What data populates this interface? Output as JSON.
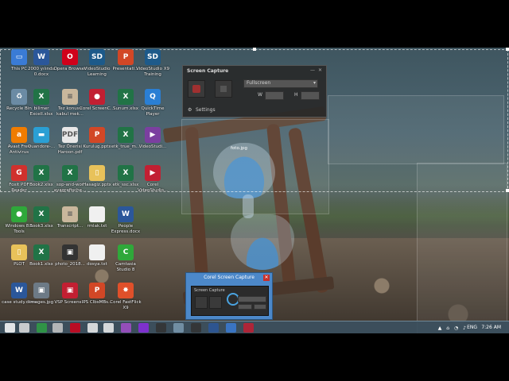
{
  "desktop_icons": [
    {
      "label": "This PC",
      "color": "#3a7bd5",
      "glyph": "▭",
      "icon": "computer-icon"
    },
    {
      "label": "2000 yılında 0.docx",
      "color": "#2b579a",
      "glyph": "W",
      "icon": "word-doc-icon"
    },
    {
      "label": "Opera Browser",
      "color": "#d0021b",
      "glyph": "O",
      "icon": "opera-icon"
    },
    {
      "label": "VideoStudio Learning",
      "color": "#1d5a8a",
      "glyph": "SD",
      "icon": "videostudio-icon"
    },
    {
      "label": "Presentati...",
      "color": "#d24726",
      "glyph": "P",
      "icon": "powerpoint-icon"
    },
    {
      "label": "VideoStudio X9 Training",
      "color": "#1d5a8a",
      "glyph": "SD",
      "icon": "videostudio-icon"
    },
    {
      "label": "Recycle Bin",
      "color": "#6b8ba4",
      "glyph": "♻",
      "icon": "recycle-bin-icon"
    },
    {
      "label": "bilimer Excell.xlsx",
      "color": "#217346",
      "glyph": "X",
      "icon": "excel-icon"
    },
    {
      "label": "Tez konusu kabul mek...",
      "color": "#c9b79c",
      "glyph": "≡",
      "icon": "document-icon"
    },
    {
      "label": "Corel ScreenC...",
      "color": "#c21f32",
      "glyph": "●",
      "icon": "corel-icon"
    },
    {
      "label": "Sunum.xlsx",
      "color": "#217346",
      "glyph": "X",
      "icon": "excel-icon"
    },
    {
      "label": "QuickTime Player",
      "color": "#2a7fd4",
      "glyph": "Q",
      "icon": "quicktime-icon"
    },
    {
      "label": "Avast Free Antivirus",
      "color": "#f07c00",
      "glyph": "a",
      "icon": "avast-icon"
    },
    {
      "label": "Quandore-...",
      "color": "#2a9fd4",
      "glyph": "▬",
      "icon": "app-icon"
    },
    {
      "label": "Tez Önerisi Haroon.pdf",
      "color": "#e8e8e8",
      "glyph": "PDF",
      "icon": "pdf-icon"
    },
    {
      "label": "Kurulug.pptx",
      "color": "#d24726",
      "glyph": "P",
      "icon": "powerpoint-icon"
    },
    {
      "label": "etk_true_m...",
      "color": "#217346",
      "glyph": "X",
      "icon": "excel-icon"
    },
    {
      "label": "VideoStudi...",
      "color": "#7b3fa0",
      "glyph": "▶",
      "icon": "videostudio-icon"
    },
    {
      "label": "Foxit PDF Reader",
      "color": "#d0312d",
      "glyph": "G",
      "icon": "foxit-icon"
    },
    {
      "label": "Book2.xlsx",
      "color": "#217346",
      "glyph": "X",
      "icon": "excel-icon"
    },
    {
      "label": "sop-and-wor ayagrafische...",
      "color": "#217346",
      "glyph": "X",
      "icon": "excel-icon"
    },
    {
      "label": "Hasagiz.pptx",
      "color": "#e8c25a",
      "glyph": "▯",
      "icon": "folder-icon"
    },
    {
      "label": "etk_ssc.xlsx",
      "color": "#217346",
      "glyph": "X",
      "icon": "excel-icon"
    },
    {
      "label": "Corel VideoStudio...",
      "color": "#c21f32",
      "glyph": "▶",
      "icon": "corel-icon"
    },
    {
      "label": "Windows 8.1 Tools",
      "color": "#2fa83a",
      "glyph": "●",
      "icon": "windows-tools-icon"
    },
    {
      "label": "Book3.xlsx",
      "color": "#217346",
      "glyph": "X",
      "icon": "excel-icon"
    },
    {
      "label": "Transcript...",
      "color": "#c9b79c",
      "glyph": "≡",
      "icon": "document-icon"
    },
    {
      "label": "rmlak.txt",
      "color": "#f0f0f0",
      "glyph": "",
      "icon": "text-file-icon"
    },
    {
      "label": "People Express.docx",
      "color": "#2b579a",
      "glyph": "W",
      "icon": "word-doc-icon"
    },
    {
      "label": "",
      "color": "",
      "glyph": "",
      "icon": ""
    },
    {
      "label": "PLOT",
      "color": "#e8c25a",
      "glyph": "▯",
      "icon": "folder-icon"
    },
    {
      "label": "Book1.xlsx",
      "color": "#217346",
      "glyph": "X",
      "icon": "excel-icon"
    },
    {
      "label": "photo_2018...",
      "color": "#333333",
      "glyph": "▣",
      "icon": "image-icon"
    },
    {
      "label": "dosya.txt",
      "color": "#f0f0f0",
      "glyph": "",
      "icon": "text-file-icon"
    },
    {
      "label": "Camtasia Studio 8",
      "color": "#2fa83a",
      "glyph": "C",
      "icon": "camtasia-icon"
    },
    {
      "label": "",
      "color": "",
      "glyph": "",
      "icon": ""
    },
    {
      "label": "case study.docx",
      "color": "#2b579a",
      "glyph": "W",
      "icon": "word-doc-icon"
    },
    {
      "label": "images.jpg",
      "color": "#6d7a86",
      "glyph": "▣",
      "icon": "image-icon"
    },
    {
      "label": "VSP Screens...",
      "color": "#c21f32",
      "glyph": "▣",
      "icon": "app-icon"
    },
    {
      "label": "IPS ClbsMBs...",
      "color": "#d24726",
      "glyph": "P",
      "icon": "powerpoint-icon"
    },
    {
      "label": "Corel FastFlick X9",
      "color": "#e0502a",
      "glyph": "✸",
      "icon": "fastflick-icon"
    },
    {
      "label": "",
      "color": "",
      "glyph": "",
      "icon": ""
    }
  ],
  "screen_capture_toolbar": {
    "title": "Screen Capture",
    "mode_select": "Fullscreen",
    "w_label": "W",
    "h_label": "H",
    "settings_label": "Settings"
  },
  "overlay": {
    "file_label": "foto.jpg"
  },
  "corel_window": {
    "title": "Corel Screen Capture",
    "inner_title": "Screen Capture"
  },
  "taskbar": {
    "lang": "ENG",
    "time": "7:26 AM",
    "apps": [
      {
        "color": "#ffffff",
        "icon": "start-icon"
      },
      {
        "color": "#e0e0e0",
        "icon": "file-explorer-icon"
      },
      {
        "color": "#2ea043",
        "icon": "excel-taskbar-icon"
      },
      {
        "color": "#c8c8c8",
        "icon": "app-icon"
      },
      {
        "color": "#d0021b",
        "icon": "opera-taskbar-icon"
      },
      {
        "color": "#f0f0f0",
        "icon": "document-taskbar-icon"
      },
      {
        "color": "#f0f0f0",
        "icon": "document-taskbar-icon"
      },
      {
        "color": "#a34fc9",
        "icon": "media-icon"
      },
      {
        "color": "#8a2be2",
        "icon": "videostudio-taskbar-icon"
      },
      {
        "color": "#333333",
        "icon": "app-icon"
      },
      {
        "color": "#7a9ab0",
        "icon": "app-icon"
      },
      {
        "color": "#333333",
        "icon": "screen-capture-taskbar-icon"
      },
      {
        "color": "#2b579a",
        "icon": "app-icon"
      },
      {
        "color": "#3a7bd5",
        "icon": "app-icon"
      },
      {
        "color": "#c21f32",
        "icon": "corel-taskbar-icon"
      }
    ]
  }
}
